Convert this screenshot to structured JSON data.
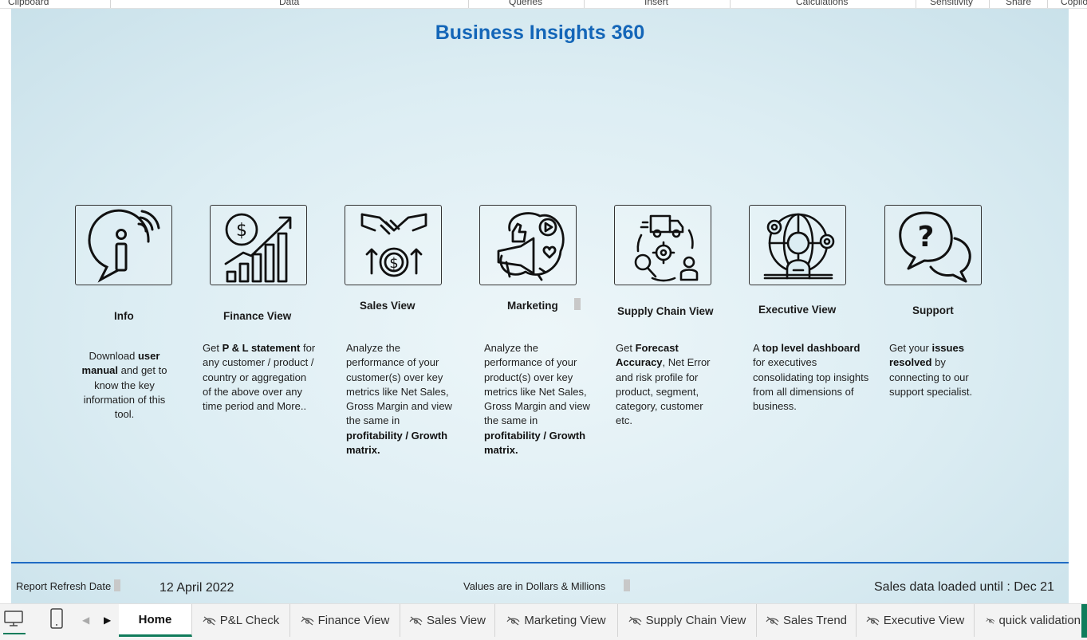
{
  "ribbon": {
    "groups": [
      "Clipboard",
      "Data",
      "Queries",
      "Insert",
      "Calculations",
      "Sensitivity",
      "Share",
      "Copilot"
    ]
  },
  "report": {
    "title": "Business Insights 360",
    "cards": [
      {
        "name": "Info",
        "icon": "info-icon"
      },
      {
        "name": "Finance View",
        "icon": "finance-chart-icon"
      },
      {
        "name": "Sales View",
        "icon": "handshake-dollar-icon"
      },
      {
        "name": "Marketing",
        "icon": "marketing-megaphone-icon"
      },
      {
        "name": "Supply Chain View",
        "icon": "supply-chain-icon"
      },
      {
        "name": "Executive View",
        "icon": "executive-icon"
      },
      {
        "name": "Support",
        "icon": "support-chat-icon"
      }
    ],
    "descriptions": {
      "info": {
        "p1": "Download ",
        "b1": "user manual",
        "p2": " and get to know the key information of this tool."
      },
      "finance": {
        "p1": "Get ",
        "b1": "P & L statement",
        "p2": " for any customer / product / country or aggregation of the above over any time period and More.."
      },
      "sales": {
        "p1": "Analyze the performance of your customer(s) over key metrics like Net Sales, Gross Margin and view the same in ",
        "b1": "profitability / Growth matrix."
      },
      "marketing": {
        "p1": "Analyze the performance of your product(s) over key metrics like Net Sales, Gross Margin and view the same in ",
        "b1": "profitability / Growth matrix."
      },
      "supply": {
        "p1": "Get ",
        "b1": "Forecast Accuracy",
        "p2": ", Net Error and risk profile for product, segment, category, customer etc."
      },
      "executive": {
        "p1": "A ",
        "b1": "top level dashboard",
        "p2": " for executives consolidating top insights from all dimensions of business."
      },
      "support": {
        "p1": "Get your ",
        "b1": "issues resolved",
        "p2": " by connecting to our support specialist."
      }
    },
    "footer": {
      "refresh_label": "Report Refresh Date",
      "refresh_date": "12 April 2022",
      "values_note": "Values are in Dollars & Millions",
      "sales_loaded": "Sales data loaded until : Dec 21"
    }
  },
  "tabs": {
    "items": [
      "Home",
      "P&L Check",
      "Finance View",
      "Sales View",
      "Marketing View",
      "Supply Chain View",
      "Sales Trend",
      "Executive View",
      "quick validation"
    ],
    "active": "Home",
    "hidden_icon": "eye-off-icon"
  },
  "colors": {
    "title": "#1466b8",
    "rule": "#1f6bc4",
    "active_tab_underline": "#107c5b",
    "canvas": "#dcedf3"
  }
}
